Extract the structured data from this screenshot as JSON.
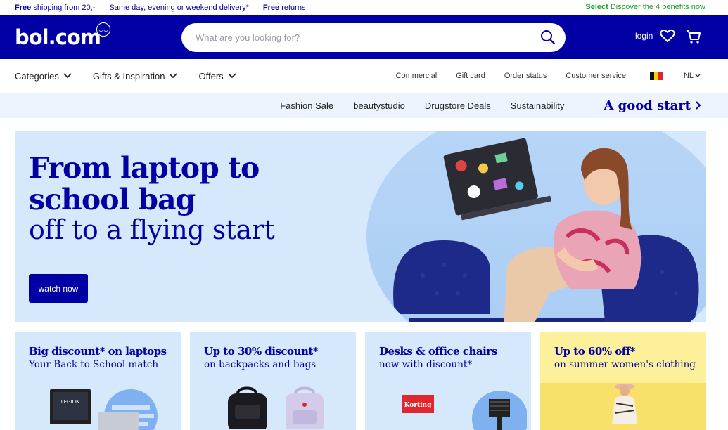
{
  "topbar": {
    "shipping_bold": "Free",
    "shipping_rest": "shipping from 20,-",
    "delivery": "Same day, evening or weekend delivery*",
    "returns_bold": "Free",
    "returns_rest": "returns",
    "select_bold": "Select",
    "select_rest": "Discover the 4 benefits now"
  },
  "header": {
    "logo": "bol.com",
    "search_placeholder": "What are you looking for?",
    "login": "login"
  },
  "nav": {
    "menus": [
      {
        "label": "Categories"
      },
      {
        "label": "Gifts & Inspiration"
      },
      {
        "label": "Offers"
      }
    ],
    "links": [
      "Commercial",
      "Gift card",
      "Order status",
      "Customer service"
    ],
    "language": "NL"
  },
  "subnav": {
    "items": [
      "Fashion Sale",
      "beautystudio",
      "Drugstore Deals",
      "Sustainability"
    ],
    "highlight": "A good start"
  },
  "hero": {
    "title_line1": "From laptop to",
    "title_line2": "school bag",
    "subtitle": "off to a flying start",
    "button": "watch now"
  },
  "cards": [
    {
      "title": "Big discount* on laptops",
      "subtitle": "Your Back to School match",
      "image_label": "LEGION"
    },
    {
      "title": "Up to 30% discount*",
      "subtitle": "on backpacks and bags"
    },
    {
      "title": "Desks & office chairs",
      "subtitle": "now with discount*",
      "image_label": "Korting"
    },
    {
      "title": "Up to 60% off*",
      "subtitle": "on summer women's clothing"
    }
  ],
  "colors": {
    "brand_blue": "#0000a4",
    "select_green": "#18a22b",
    "light_blue": "#d6e8fc",
    "yellow": "#fdf09a"
  }
}
